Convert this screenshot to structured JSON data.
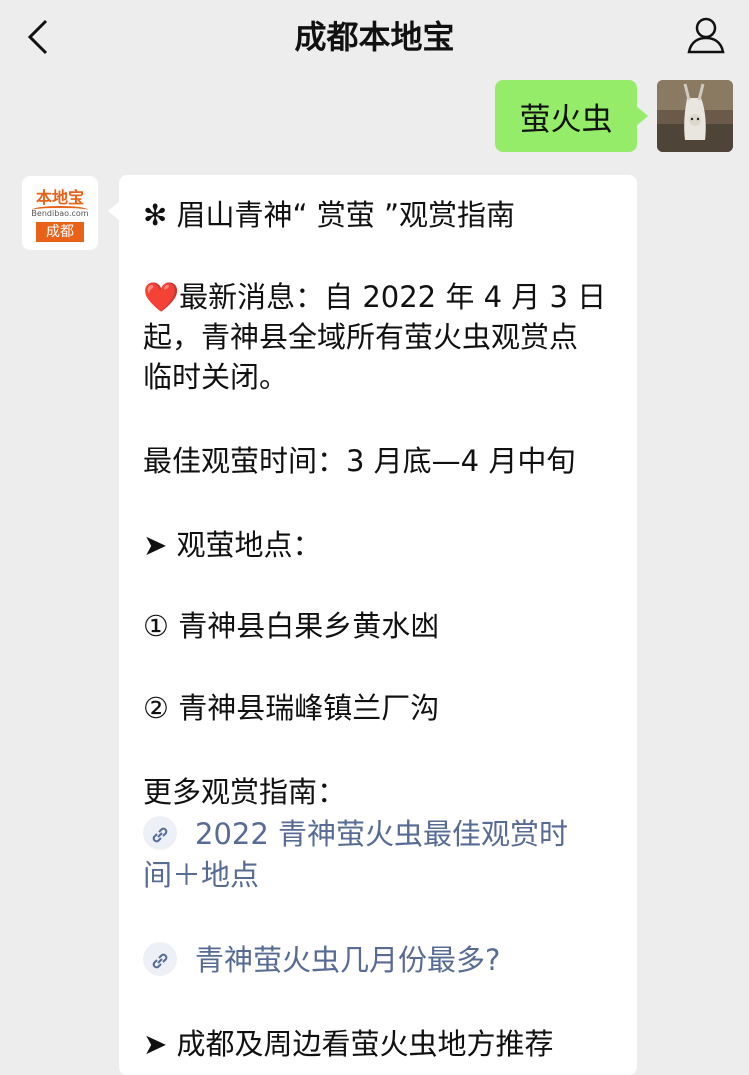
{
  "header": {
    "title": "成都本地宝",
    "back_icon": "chevron-left-icon",
    "profile_icon": "person-icon"
  },
  "outgoing": {
    "text": "萤火虫"
  },
  "bot": {
    "logo_top": "本地宝",
    "logo_domain": "Bendibao.com",
    "logo_city": "成都"
  },
  "message": {
    "title": "✻ 眉山青神“ 赏萤 ”观赏指南",
    "news_1": "❤️最新消息：自 2022 年 4 月 3 日",
    "news_2": "起，青神县全域所有萤火虫观赏点",
    "news_3": "临时关闭。",
    "best_time": "最佳观萤时间：3 月底—4 月中旬",
    "locations_heading": "➤ 观萤地点：",
    "location_1": "① 青神县白果乡黄水凼",
    "location_2": "② 青神县瑞峰镇兰厂沟",
    "more_guides": "更多观赏指南：",
    "link_1_line1": "2022 青神萤火虫最佳观赏时",
    "link_1_line2": "间＋地点",
    "link_2": "青神萤火虫几月份最多?",
    "recommend": "➤ 成都及周边看萤火虫地方推荐"
  },
  "colors": {
    "background": "#ededed",
    "outgoing_bubble": "#95ec69",
    "link": "#576b95",
    "brand": "#e8621a"
  }
}
